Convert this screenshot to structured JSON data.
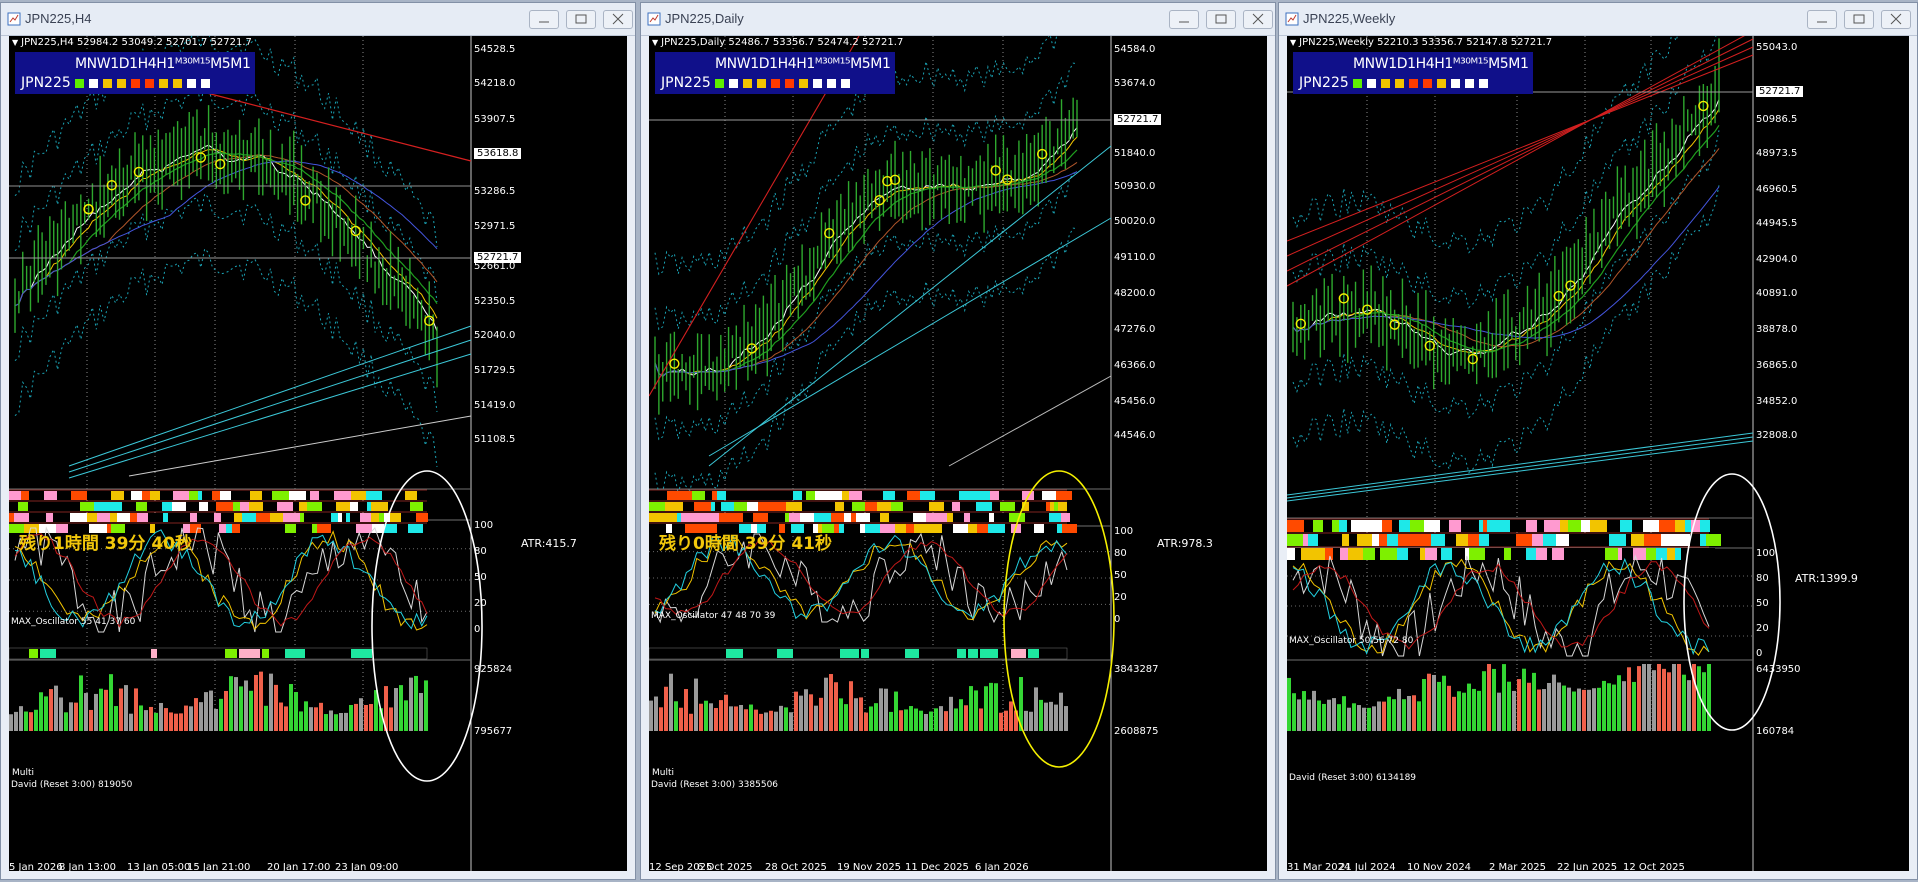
{
  "windows": [
    {
      "title": "JPN225,H4",
      "info": "JPN225,H4  52984.2 53049.2 52701.7 52721.7",
      "tf_row": "MNW1D1H4H1ᴹ³⁰ᴹ¹⁵M5M1",
      "symbol": "JPN225",
      "tf_colors": [
        "#5ff000",
        "#ffffff",
        "#f2c400",
        "#f2c400",
        "#ff3a00",
        "#ff3a00",
        "#f2c400",
        "#f2c400",
        "#ffffff",
        "#ffffff"
      ],
      "prices": [
        "54528.5",
        "54218.0",
        "53907.5",
        "53618.8",
        "53286.5",
        "52971.5",
        "52721.7",
        "52661.0",
        "52350.5",
        "52040.0",
        "51729.5",
        "51419.0",
        "51108.5"
      ],
      "current_price": "52721.7",
      "level_line": "53618.8",
      "timer": "残り1時間 39分 40秒",
      "atr": "ATR:415.7",
      "osc_label": "MAX_Oscillator 55 41 37 60",
      "osc_scale": [
        "100",
        "80",
        "50",
        "20",
        "0"
      ],
      "multi_label": "Multi",
      "vol_label": "David (Reset 3:00) 819050",
      "vol_scale": [
        "925824",
        "795677"
      ],
      "dates": [
        "5 Jan 2026",
        "8 Jan 13:00",
        "13 Jan 05:00",
        "15 Jan 21:00",
        "20 Jan 17:00",
        "23 Jan 09:00"
      ]
    },
    {
      "title": "JPN225,Daily",
      "info": "JPN225,Daily  52486.7 53356.7 52474.2 52721.7",
      "tf_row": "MNW1D1H4H1ᴹ³⁰ᴹ¹⁵M5M1",
      "symbol": "JPN225",
      "tf_colors": [
        "#5ff000",
        "#ffffff",
        "#f2c400",
        "#f2c400",
        "#ff3a00",
        "#ff3a00",
        "#f2c400",
        "#ffffff",
        "#ffffff",
        "#ffffff"
      ],
      "prices": [
        "54584.0",
        "53674.0",
        "52721.7",
        "51840.0",
        "50930.0",
        "50020.0",
        "49110.0",
        "48200.0",
        "47276.0",
        "46366.0",
        "45456.0",
        "44546.0"
      ],
      "current_price": "52721.7",
      "timer": "残り0時間 39分 41秒",
      "atr": "ATR:978.3",
      "osc_label": "MAX_Oscillator 47 48 70 39",
      "osc_scale": [
        "100",
        "80",
        "50",
        "20",
        "0"
      ],
      "multi_label": "Multi",
      "vol_label": "David (Reset 3:00) 3385506",
      "vol_scale": [
        "3843287",
        "2608875"
      ],
      "dates": [
        "12 Sep 2025",
        "6 Oct 2025",
        "28 Oct 2025",
        "19 Nov 2025",
        "11 Dec 2025",
        "6 Jan 2026"
      ]
    },
    {
      "title": "JPN225,Weekly",
      "info": "JPN225,Weekly  52210.3 53356.7 52147.8 52721.7",
      "tf_row": "MNW1D1H4H1ᴹ³⁰ᴹ¹⁵M5M1",
      "symbol": "JPN225",
      "tf_colors": [
        "#5ff000",
        "#ffffff",
        "#f2c400",
        "#f2c400",
        "#ff3a00",
        "#ff3a00",
        "#f2c400",
        "#ffffff",
        "#ffffff",
        "#ffffff"
      ],
      "prices": [
        "55043.0",
        "52721.7",
        "50986.5",
        "48973.5",
        "46960.5",
        "44945.5",
        "42904.0",
        "40891.0",
        "38878.0",
        "36865.0",
        "34852.0",
        "32808.0"
      ],
      "current_price": "52721.7",
      "timer": "",
      "atr": "ATR:1399.9",
      "osc_label": "MAX_Oscillator 50 56 72 80",
      "osc_scale": [
        "100",
        "80",
        "50",
        "20",
        "0"
      ],
      "multi_label": "",
      "vol_label": "David (Reset 3:00) 6134189",
      "vol_scale": [
        "6433950",
        "160784"
      ],
      "dates": [
        "31 Mar 2024",
        "21 Jul 2024",
        "10 Nov 2024",
        "2 Mar 2025",
        "22 Jun 2025",
        "12 Oct 2025"
      ]
    }
  ]
}
